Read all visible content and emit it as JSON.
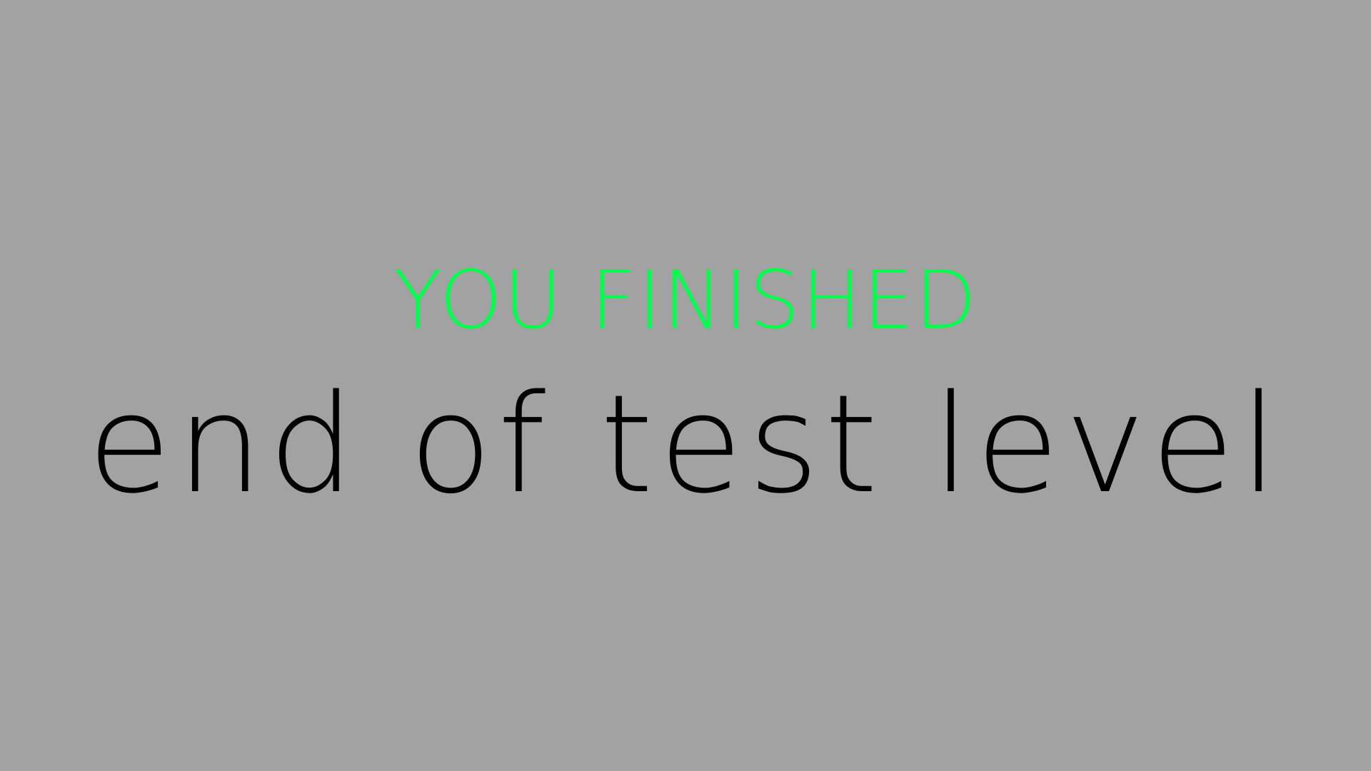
{
  "end_screen": {
    "headline": "YOU FINISHED",
    "level_name": "end of test level"
  },
  "colors": {
    "background": "#a2a2a2",
    "headline": "#00ff4c",
    "level_name": "#000000"
  }
}
